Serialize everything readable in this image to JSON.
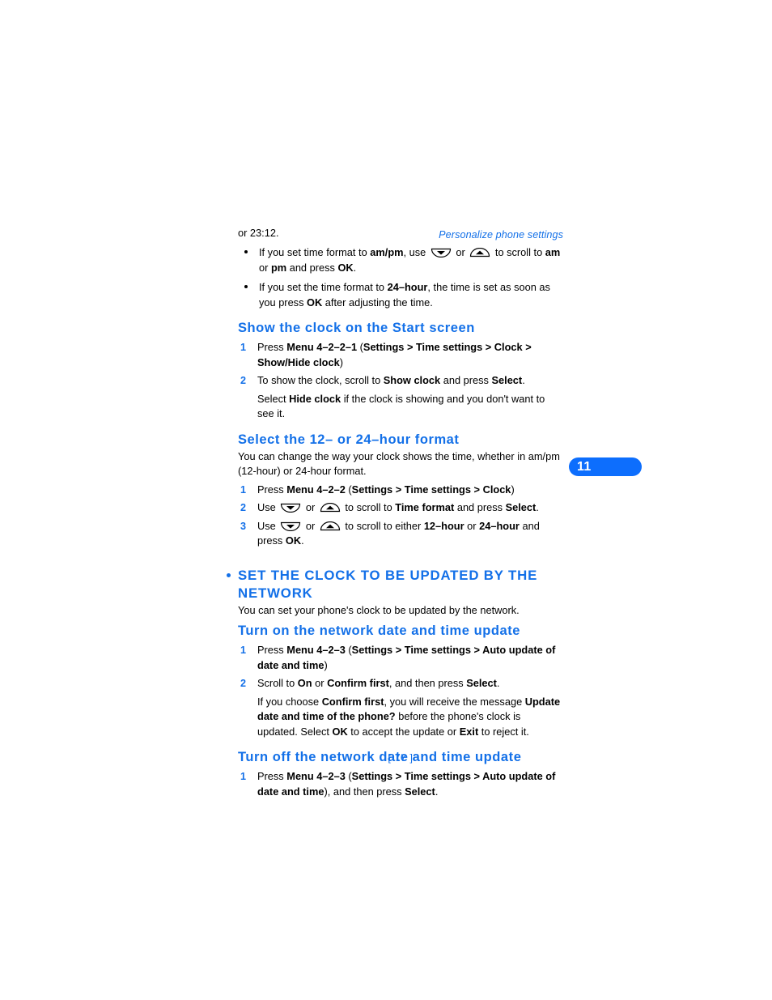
{
  "document": {
    "running_head": "Personalize phone settings",
    "chapter_tab": "11",
    "page_number": "[ 77 ]",
    "accent_color": "#1370e8",
    "tab_color": "#0d6efd"
  },
  "icons": {
    "scroll_down": "scroll-down-key-icon",
    "scroll_up": "scroll-up-key-icon"
  },
  "intro": {
    "continued_line": "or 23:12.",
    "bullets": [
      {
        "part1": "If you set time format to ",
        "bold1": "am/pm",
        "part2": ", use ",
        "part3": " or ",
        "part4": " to scroll to ",
        "bold2": "am",
        "part5": " or ",
        "bold3": "pm",
        "part6": " and press ",
        "bold4": "OK",
        "part7": "."
      },
      {
        "part1": "If you set the time format to ",
        "bold1": "24–hour",
        "part2": ", the time is set as soon as you press ",
        "bold2": "OK",
        "part3": " after adjusting the time."
      }
    ]
  },
  "section_show_clock": {
    "heading": "Show the clock on the Start screen",
    "step1": {
      "num": "1",
      "part1": "Press ",
      "bold1": "Menu 4–2–2–1",
      "part2": " (",
      "bold2": "Settings > Time settings > Clock > Show/Hide clock",
      "part3": ")"
    },
    "step2": {
      "num": "2",
      "part1": "To show the clock, scroll to ",
      "bold1": "Show clock",
      "part2": " and press ",
      "bold2": "Select",
      "part3": "."
    },
    "step2_sub": {
      "part1": "Select ",
      "bold1": "Hide clock",
      "part2": " if the clock is showing and you don't want to see it."
    }
  },
  "section_time_format": {
    "heading": "Select the 12– or 24–hour format",
    "intro": "You can change the way your clock shows the time, whether in am/pm (12-hour) or 24-hour format.",
    "step1": {
      "num": "1",
      "part1": "Press ",
      "bold1": "Menu 4–2–2",
      "part2": " (",
      "bold2": "Settings > Time settings > Clock",
      "part3": ")"
    },
    "step2": {
      "num": "2",
      "part1": "Use ",
      "part2": " or ",
      "part3": " to scroll to ",
      "bold1": "Time format",
      "part4": " and press ",
      "bold2": "Select",
      "part5": "."
    },
    "step3": {
      "num": "3",
      "part1": "Use ",
      "part2": " or ",
      "part3": " to scroll to either ",
      "bold1": "12–hour",
      "part4": " or ",
      "bold2": "24–hour",
      "part5": " and press ",
      "bold3": "OK",
      "part6": "."
    }
  },
  "section_network": {
    "heading": "SET THE CLOCK TO BE UPDATED BY THE NETWORK",
    "intro": "You can set your phone's clock to be updated by the network.",
    "turn_on": {
      "heading": "Turn on the network date and time update",
      "step1": {
        "num": "1",
        "part1": "Press ",
        "bold1": "Menu 4–2–3",
        "part2": " (",
        "bold2": "Settings > Time settings > Auto update of date and time",
        "part3": ")"
      },
      "step2": {
        "num": "2",
        "part1": "Scroll to ",
        "bold1": "On",
        "part2": " or ",
        "bold2": "Confirm first",
        "part3": ", and then press ",
        "bold3": "Select",
        "part4": "."
      },
      "step2_sub": {
        "part1": "If you choose ",
        "bold1": "Confirm first",
        "part2": ", you will receive the message ",
        "bold2": "Update date and time of the phone?",
        "part3": " before the phone's clock is updated. Select ",
        "bold3": "OK",
        "part4": " to accept the update or ",
        "bold4": "Exit",
        "part5": " to reject it."
      }
    },
    "turn_off": {
      "heading": "Turn off the network date and time update",
      "step1": {
        "num": "1",
        "part1": "Press ",
        "bold1": "Menu 4–2–3",
        "part2": " (",
        "bold2": "Settings > Time settings > Auto update of date and time",
        "part3": "), and then press ",
        "bold3": "Select",
        "part4": "."
      }
    }
  }
}
